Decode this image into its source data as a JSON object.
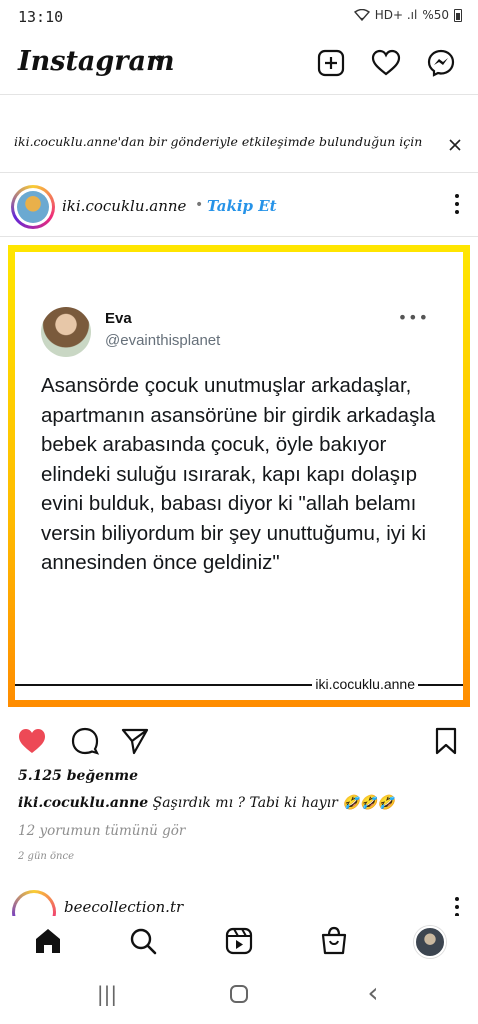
{
  "status_bar": {
    "time": "13:10",
    "indicators": "HD+ .ıl",
    "battery": "%50"
  },
  "header": {
    "logo": "Instagram",
    "icons": [
      "plus-square-icon",
      "heart-icon",
      "messenger-icon"
    ]
  },
  "suggestion": {
    "text": "iki.cocuklu.anne'dan bir gönderiyle etkileşimde bulunduğun için"
  },
  "post": {
    "username": "iki.cocuklu.anne",
    "dot": "•",
    "follow_label": "Takip Et",
    "tweet": {
      "name": "Eva",
      "handle": "@evainthisplanet",
      "more": "•••",
      "body": "Asansörde çocuk unutmuşlar arkadaşlar, apartmanın asansörüne bir girdik arkadaşla bebek arabasında çocuk, öyle bakıyor elindeki suluğu ısırarak, kapı kapı dolaşıp evini bulduk, babası diyor ki \"allah belamı versin biliyordum bir şey unuttuğumu, iyi ki annesinden önce geldiniz\"",
      "watermark": "iki.cocuklu.anne"
    },
    "likes": "5.125 beğenme",
    "caption_user": "iki.cocuklu.anne",
    "caption_text": " Şaşırdık mı ? Tabi ki hayır 🤣🤣🤣",
    "comments_link": "12 yorumun tümünü gör",
    "time": "2 gün önce",
    "liked": true,
    "accent_color": "#2693e8",
    "like_color": "#ed4956"
  },
  "next_post": {
    "username": "beecollection.tr"
  },
  "bottom_nav": {
    "items": [
      "home-icon",
      "search-icon",
      "reels-icon",
      "shop-icon",
      "profile-avatar"
    ]
  },
  "android_nav": {
    "recent": "|||",
    "back": "‹"
  }
}
